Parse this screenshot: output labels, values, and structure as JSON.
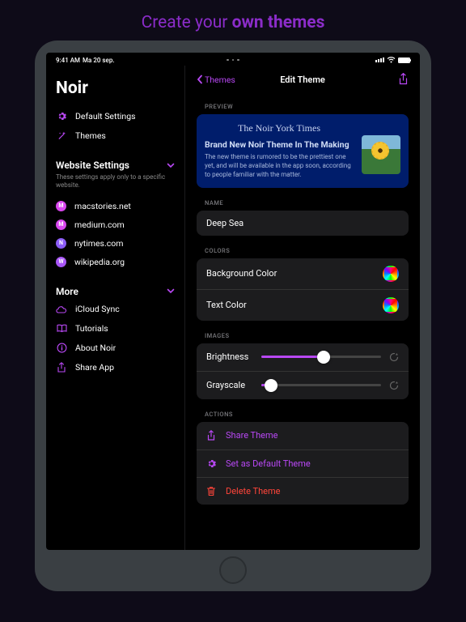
{
  "headline": {
    "prefix": "Create your ",
    "bold": "own themes"
  },
  "status": {
    "time": "9:41 AM",
    "date": "Ma 20 sep."
  },
  "sidebar": {
    "app_title": "Noir",
    "top": [
      {
        "icon": "gear",
        "label": "Default Settings"
      },
      {
        "icon": "wand",
        "label": "Themes"
      }
    ],
    "website": {
      "title": "Website Settings",
      "desc": "These settings apply only to a specific website.",
      "items": [
        {
          "badge": "M",
          "badge_class": "badge-m",
          "label": "macstories.net"
        },
        {
          "badge": "M",
          "badge_class": "badge-m",
          "label": "medium.com"
        },
        {
          "badge": "N",
          "badge_class": "badge-n",
          "label": "nytimes.com"
        },
        {
          "badge": "W",
          "badge_class": "badge-w",
          "label": "wikipedia.org"
        }
      ]
    },
    "more": {
      "title": "More",
      "items": [
        {
          "icon": "cloud",
          "label": "iCloud Sync"
        },
        {
          "icon": "book",
          "label": "Tutorials"
        },
        {
          "icon": "info",
          "label": "About Noir"
        },
        {
          "icon": "share",
          "label": "Share App"
        }
      ]
    }
  },
  "detail": {
    "back": "Themes",
    "title": "Edit Theme",
    "preview": {
      "label": "PREVIEW",
      "masthead": "The Noir York Times",
      "headline": "Brand New Noir Theme In The Making",
      "body": "The new theme is rumored to be the prettiest one yet, and will be available in the app soon, according to people familiar with the matter."
    },
    "name": {
      "label": "NAME",
      "value": "Deep Sea"
    },
    "colors": {
      "label": "COLORS",
      "bg": {
        "label": "Background Color",
        "hex": "#001d6b"
      },
      "text": {
        "label": "Text Color",
        "hex": "#c8ecf5"
      }
    },
    "images": {
      "label": "IMAGES",
      "brightness": {
        "label": "Brightness",
        "value": 52
      },
      "grayscale": {
        "label": "Grayscale",
        "value": 8
      }
    },
    "actions": {
      "label": "ACTIONS",
      "share": "Share Theme",
      "default": "Set as Default Theme",
      "delete": "Delete Theme"
    }
  }
}
